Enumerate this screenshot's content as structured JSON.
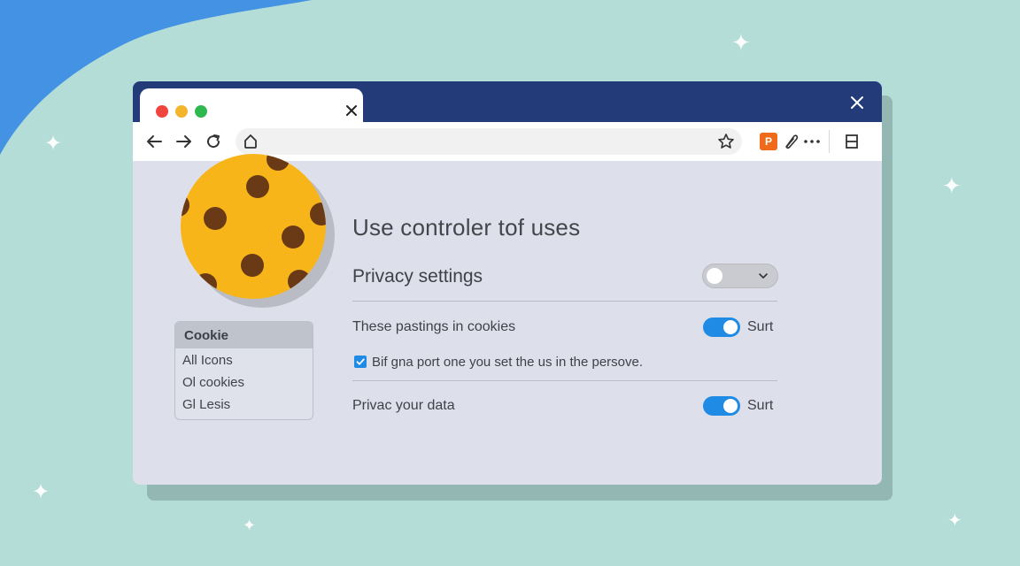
{
  "colors": {
    "background": "#b4ddd8",
    "blob": "#4392e3",
    "titlebar": "#243b7a",
    "content": "#dde0ea",
    "accent": "#1f8be4",
    "cookie": "#f8b51a",
    "cookie_chip": "#6a3a17"
  },
  "browser": {
    "address": {
      "value": "",
      "placeholder": ""
    },
    "extension_label": "P",
    "icons": [
      "back-arrow-icon",
      "forward-arrow-icon",
      "reload-icon",
      "site-lock-icon",
      "star-icon",
      "pin-icon",
      "more-icon",
      "sidebar-icon"
    ]
  },
  "sidebar_menu": {
    "header": "Cookie",
    "items": [
      "All Icons",
      "Ol cookies",
      "Gl Lesis"
    ]
  },
  "panel": {
    "title": "Use controler tof uses",
    "privacy_settings_label": "Privacy settings",
    "row1_label": "These pastings in cookies",
    "row1_toggle_label": "Surt",
    "checkbox_label": "Bif gna port one you set the us in the persove.",
    "row2_label": "Privac your data",
    "row2_toggle_label": "Surt"
  }
}
